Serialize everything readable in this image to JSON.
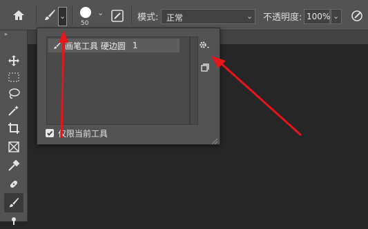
{
  "optionsbar": {
    "home_icon": "home-icon",
    "brush_icon": "brush-icon",
    "brush_size": "50",
    "mode_label": "模式:",
    "mode_value": "正常",
    "opacity_label": "不透明度:",
    "opacity_value": "100%"
  },
  "panel": {
    "preset_name": "画笔工具 硬边圆",
    "preset_size": "1",
    "checkbox_label": "仅限当前工具",
    "checkbox_checked": true
  },
  "colors": {
    "arrow": "#e8151b",
    "panel_bg": "#535353",
    "canvas_bg": "#262626"
  }
}
